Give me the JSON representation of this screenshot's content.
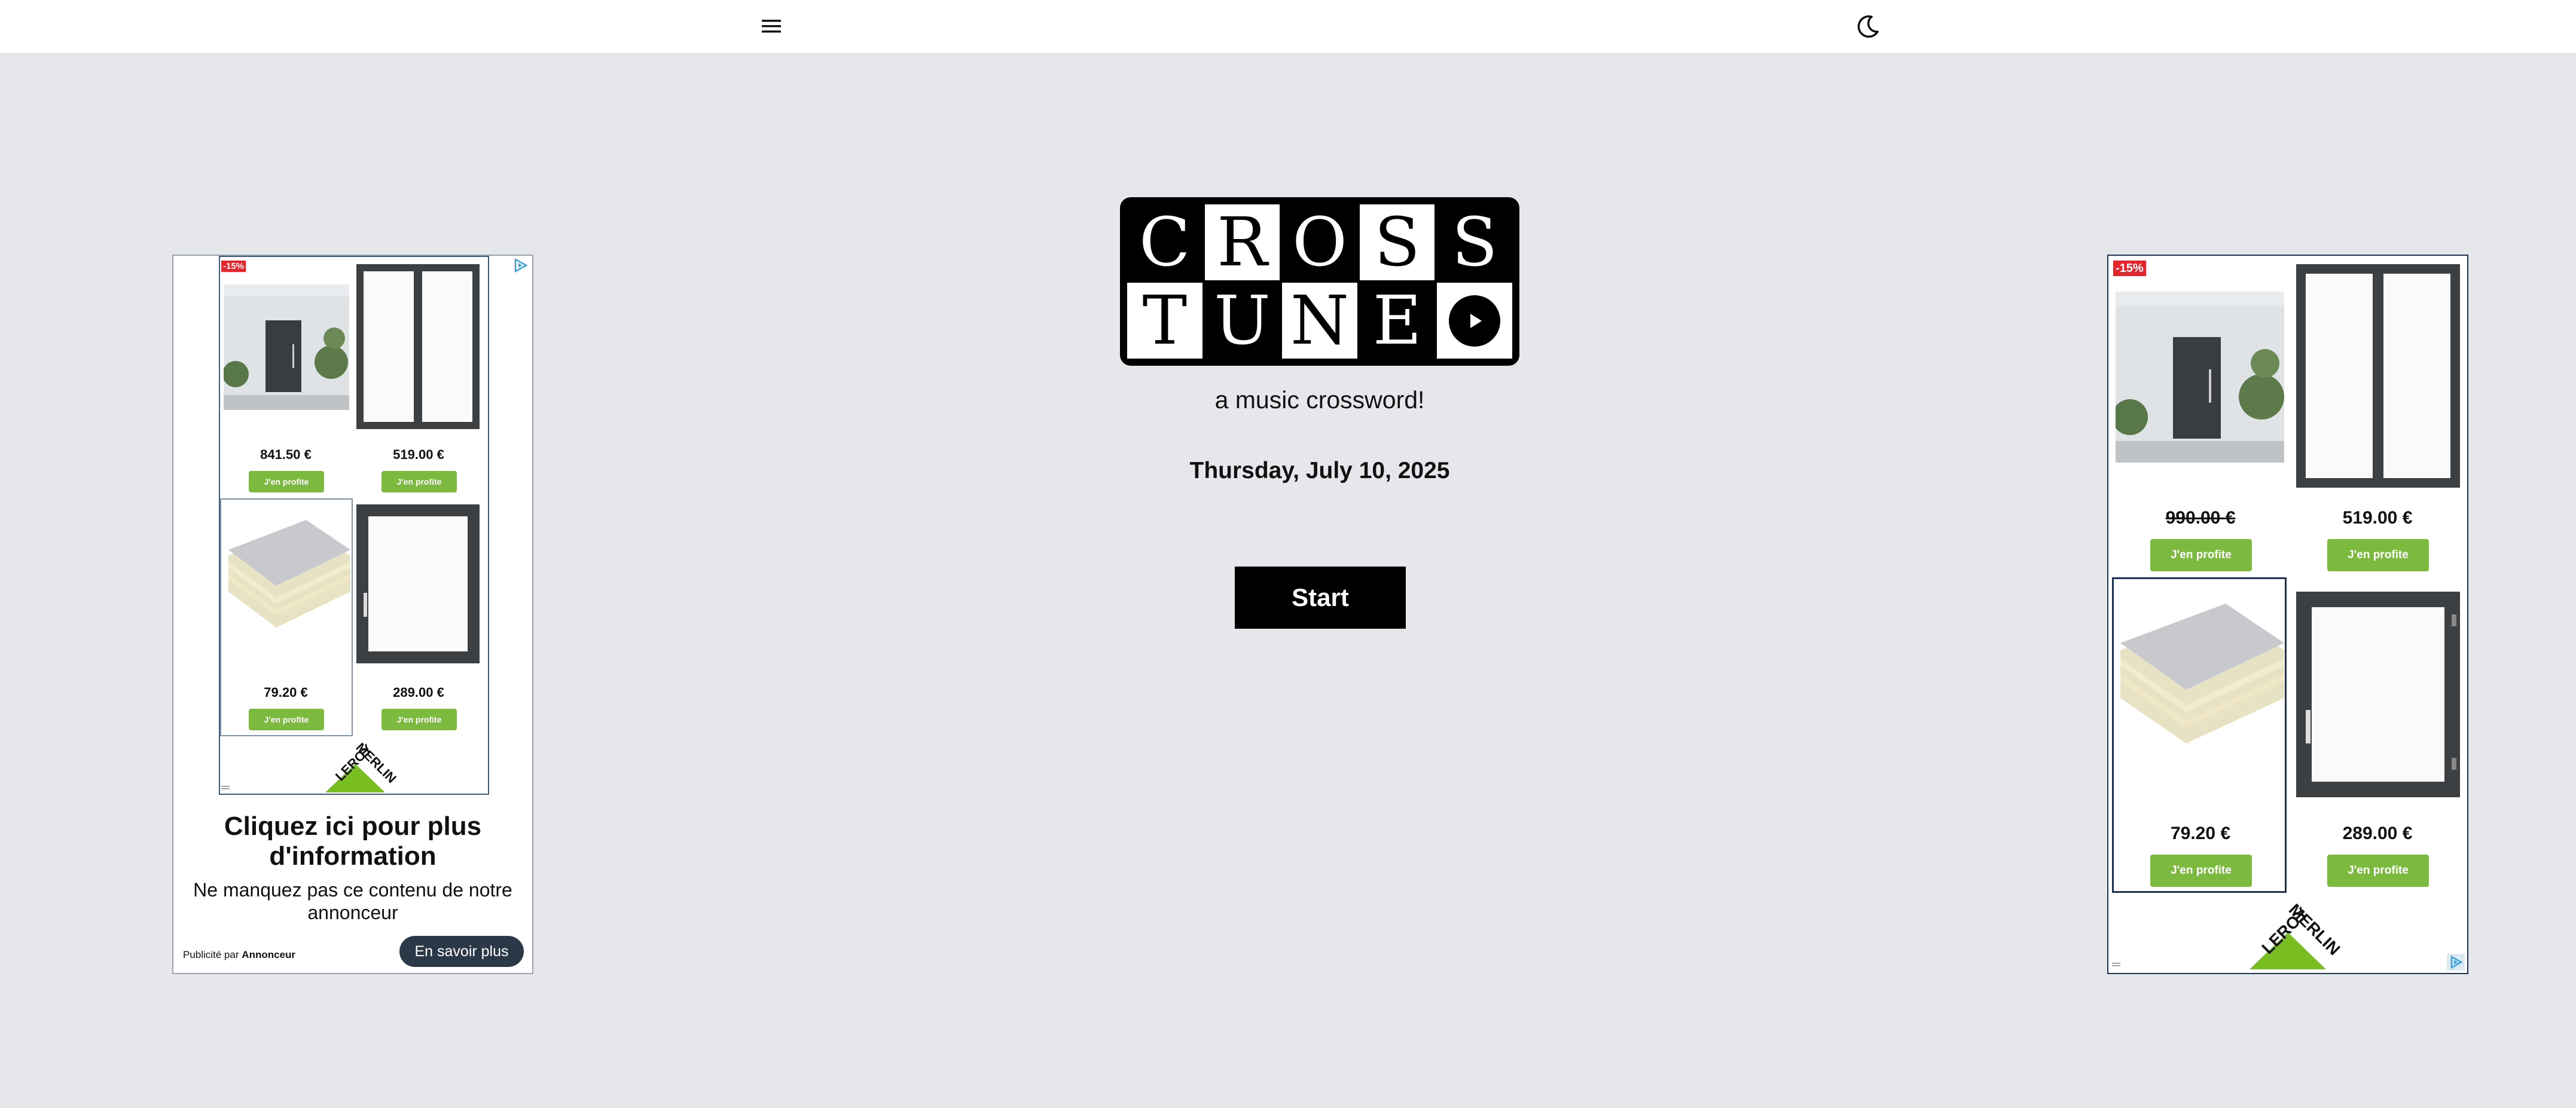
{
  "header": {
    "menu_icon": "hamburger-menu-icon",
    "theme_icon": "moon-icon"
  },
  "logo": {
    "row1": [
      "C",
      "R",
      "O",
      "S",
      "S"
    ],
    "row2": [
      "T",
      "U",
      "N",
      "E"
    ],
    "play_icon": "play-icon"
  },
  "main": {
    "tagline": "a music crossword!",
    "date": "Thursday, July 10, 2025",
    "start_label": "Start"
  },
  "ad_left": {
    "badge": "-15%",
    "products": [
      {
        "price": "841.50 €",
        "cta": "J'en profite",
        "image": "door-photo"
      },
      {
        "price": "519.00 €",
        "cta": "J'en profite",
        "image": "double-window"
      },
      {
        "price": "79.20 €",
        "cta": "J'en profite",
        "image": "insulation-panels"
      },
      {
        "price": "289.00 €",
        "cta": "J'en profite",
        "image": "single-window"
      }
    ],
    "brand_lines": [
      "LEROY",
      "MERLIN"
    ],
    "title": "Cliquez ici pour plus d'information",
    "body": "Ne manquez pas ce contenu de notre annonceur",
    "sponsor_prefix": "Publicité par",
    "sponsor_name": "Annonceur",
    "learn_more": "En savoir plus"
  },
  "ad_right": {
    "badge": "-15%",
    "products": [
      {
        "price": "990.00 €",
        "cta": "J'en profite",
        "image": "door-photo",
        "strikethrough": true
      },
      {
        "price": "519.00 €",
        "cta": "J'en profite",
        "image": "double-window"
      },
      {
        "price": "79.20 €",
        "cta": "J'en profite",
        "image": "insulation-panels"
      },
      {
        "price": "289.00 €",
        "cta": "J'en profite",
        "image": "single-window"
      }
    ],
    "brand_lines": [
      "LEROY",
      "MERLIN"
    ]
  },
  "colors": {
    "page_bg": "#e5e7eb",
    "cta_green": "#7cb93f",
    "badge_red": "#e3262c",
    "brand_green": "#78be20",
    "learn_more_bg": "#2b3848"
  }
}
